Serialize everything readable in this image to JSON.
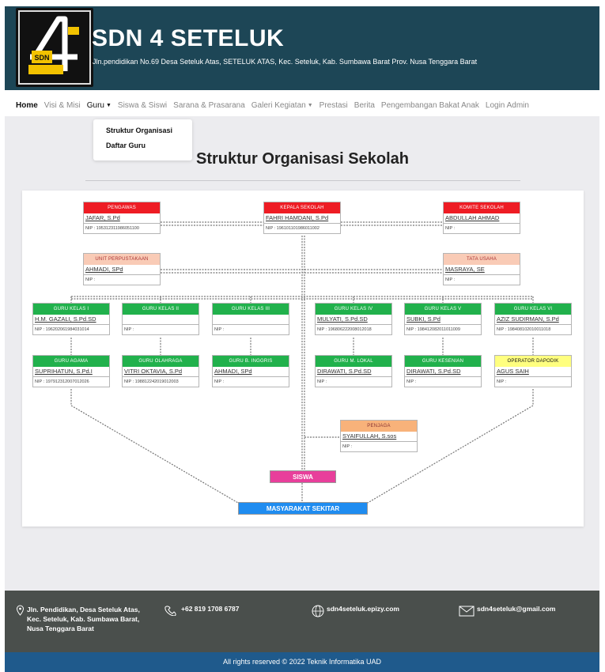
{
  "site": {
    "title": "SDN 4 SETELUK",
    "address": "Jln.pendidikan No.69 Desa Seteluk Atas, SETELUK ATAS, Kec. Seteluk, Kab. Sumbawa Barat Prov. Nusa Tenggara Barat",
    "logo_text": "SDN SETELUK"
  },
  "nav": {
    "items": [
      {
        "label": "Home",
        "dropdown": false
      },
      {
        "label": "Visi & Misi",
        "dropdown": false
      },
      {
        "label": "Guru",
        "dropdown": true
      },
      {
        "label": "Siswa & Siswi",
        "dropdown": false
      },
      {
        "label": "Sarana & Prasarana",
        "dropdown": false
      },
      {
        "label": "Galeri Kegiatan",
        "dropdown": true
      },
      {
        "label": "Prestasi",
        "dropdown": false
      },
      {
        "label": "Berita",
        "dropdown": false
      },
      {
        "label": "Pengembangan Bakat Anak",
        "dropdown": false
      },
      {
        "label": "Login Admin",
        "dropdown": false
      }
    ],
    "guru_menu": [
      "Struktur Organisasi",
      "Daftar Guru"
    ]
  },
  "page_title": "Struktur Organisasi Sekolah",
  "org": {
    "pengawas": {
      "title": "PENGAWAS",
      "name": "JAFAR, S.Pd",
      "nip": "NIP : 195312311986051100"
    },
    "kepala": {
      "title": "KEPALA SEKOLAH",
      "name": "FAHRI HAMDANI, S.Pd",
      "nip": "NIP : 196101101986011002"
    },
    "komite": {
      "title": "KOMITE SEKOLAH",
      "name": "ABDULLAH AHMAD",
      "nip": "NIP :"
    },
    "perpustakaan": {
      "title": "UNIT PERPUSTAKAAN",
      "name": "AHMADI, SPd",
      "nip": "NIP :"
    },
    "tata_usaha": {
      "title": "TATA USAHA",
      "name": "MASRAYA, SE",
      "nip": "NIP :"
    },
    "row1": [
      {
        "title": "GURU KELAS I",
        "name": "H.M. GAZALI, S.Pd.SD",
        "nip": "NIP : 196202061984031014"
      },
      {
        "title": "GURU KELAS II",
        "name": "",
        "nip": "NIP :"
      },
      {
        "title": "GURU KELAS III",
        "name": "",
        "nip": "NIP :"
      },
      {
        "title": "GURU KELAS IV",
        "name": "MULYATI, S.Pd.SD",
        "nip": "NIP : 196806222008012018"
      },
      {
        "title": "GURU KELAS V",
        "name": "SUBKI, S.Pd",
        "nip": "NIP : 198412082011011009"
      },
      {
        "title": "GURU KELAS VI",
        "name": "AZIZ SUDIRMAN, S.Pd",
        "nip": "NIP : 198408102010011018"
      }
    ],
    "row2": [
      {
        "title": "GURU AGAMA",
        "name": "SUPRIHATUN, S.Pd.I",
        "nip": "NIP : 197912312007012026",
        "color": "green"
      },
      {
        "title": "GURU OLAHRAGA",
        "name": "VITRI OKTAVIA, S.Pd",
        "nip": "NIP : 198812242019012003",
        "color": "green"
      },
      {
        "title": "GURU B. INGGRIS",
        "name": "AHMADI, SPd",
        "nip": "NIP :",
        "color": "green"
      },
      {
        "title": "GURU M. LOKAL",
        "name": "DIRAWATI, S.Pd.SD",
        "nip": "NIP :",
        "color": "green"
      },
      {
        "title": "GURU KESENIAN",
        "name": "DIRAWATI, S.Pd.SD",
        "nip": "NIP :",
        "color": "green"
      },
      {
        "title": "OPERATOR DAPODIK",
        "name": "AGUS SAIH",
        "nip": "NIP :",
        "color": "yellow"
      }
    ],
    "penjaga": {
      "title": "PENJAGA",
      "name": "SYAIFULLAH, S.sos",
      "nip": "NIP :"
    },
    "siswa": "SISWA",
    "masyarakat": "MASYARAKAT SEKITAR"
  },
  "footer": {
    "address": "Jln. Pendidikan, Desa Seteluk Atas, Kec. Seteluk, Kab. Sumbawa Barat, Nusa Tenggara Barat",
    "phone": "+62 819 1708 6787",
    "website": "sdn4seteluk.epizy.com",
    "email": "sdn4seteluk@gmail.com",
    "copyright": "All rights reserved © 2022 Teknik Informatika UAD"
  },
  "colors": {
    "header_bg": "#1d4656",
    "footer_bg": "#4a4f4c",
    "copyright_bg": "#1f5a8c",
    "red": "#ee1c24",
    "green": "#21b14c",
    "pink": "#e83f9b",
    "blue": "#1f8cf0"
  }
}
